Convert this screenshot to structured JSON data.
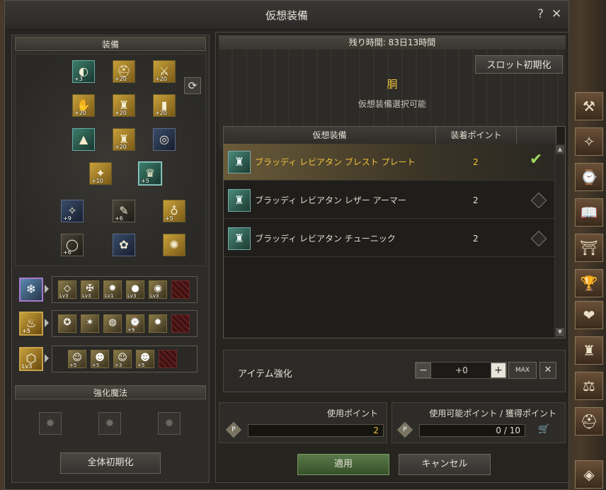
{
  "window": {
    "title": "仮想装備"
  },
  "left": {
    "equip_header": "装備",
    "equip_slots": [
      {
        "icon": "mask-icon",
        "glyph": "◐",
        "count": "+3",
        "style": "teal"
      },
      {
        "icon": "helmet-icon",
        "glyph": "⛑",
        "count": "+20",
        "style": "gold"
      },
      {
        "icon": "shoulder-icon",
        "glyph": "⚔",
        "count": "+20",
        "style": "gold"
      },
      {
        "icon": "gloves-icon",
        "glyph": "✋",
        "count": "+20",
        "style": "gold"
      },
      {
        "icon": "armor-icon",
        "glyph": "♜",
        "count": "+20",
        "style": "gold"
      },
      {
        "icon": "greaves-icon",
        "glyph": "▮",
        "count": "+20",
        "style": "gold"
      },
      {
        "icon": "cloak-icon",
        "glyph": "▲",
        "count": "",
        "style": "teal"
      },
      {
        "icon": "belt-icon",
        "glyph": "♜",
        "count": "+20",
        "style": "gold"
      },
      {
        "icon": "bracelet-icon",
        "glyph": "◎",
        "count": "",
        "style": "blue"
      },
      {
        "icon": "weapon-icon",
        "glyph": "✦",
        "count": "+10",
        "style": "gold"
      },
      {
        "icon": "chest-selected-icon",
        "glyph": "♛",
        "count": "+5",
        "style": "teal"
      },
      {
        "icon": "pendant-icon",
        "glyph": "✧",
        "count": "+9",
        "style": "blue"
      },
      {
        "icon": "book-icon",
        "glyph": "✎",
        "count": "+6",
        "style": "dark"
      },
      {
        "icon": "shirt-icon",
        "glyph": "♁",
        "count": "+5",
        "style": "gold"
      },
      {
        "icon": "ring-icon",
        "glyph": "◯",
        "count": "+6",
        "style": "dark"
      },
      {
        "icon": "rose-icon",
        "glyph": "✿",
        "count": "",
        "style": "blue"
      },
      {
        "icon": "amulet-icon",
        "glyph": "✺",
        "count": "",
        "style": "gold"
      }
    ],
    "sets": [
      {
        "main": {
          "icon": "crystal-icon",
          "glyph": "❄",
          "count": "",
          "style": "purple"
        },
        "gems": [
          {
            "icon": "diamond-icon",
            "glyph": "◇",
            "lv": "Lv3"
          },
          {
            "icon": "emerald-icon",
            "glyph": "✠",
            "lv": "Lv3"
          },
          {
            "icon": "ruby-icon",
            "glyph": "✹",
            "lv": "Lv1"
          },
          {
            "icon": "pearl-icon",
            "glyph": "●",
            "lv": "Lv3"
          },
          {
            "icon": "sapphire-icon",
            "glyph": "◉",
            "lv": "Lv3"
          },
          {
            "icon": "empty-slot-icon",
            "glyph": "",
            "lv": "",
            "red": true
          }
        ]
      },
      {
        "main": {
          "icon": "orb-icon",
          "glyph": "♨",
          "count": "+5",
          "style": "gold"
        },
        "gems": [
          {
            "icon": "demon-gem-icon",
            "glyph": "✪",
            "lv": ""
          },
          {
            "icon": "star-gem-icon",
            "glyph": "✶",
            "lv": ""
          },
          {
            "icon": "pearl-gem-icon",
            "glyph": "◍",
            "lv": ""
          },
          {
            "icon": "clock-gem-icon",
            "glyph": "⌚",
            "lv": "+9"
          },
          {
            "icon": "flame-gem-icon",
            "glyph": "✹",
            "lv": ""
          },
          {
            "icon": "empty-slot-icon",
            "glyph": "",
            "lv": "",
            "red": true
          }
        ]
      },
      {
        "main": {
          "icon": "hexagon-icon",
          "glyph": "⬡",
          "count": "Lv3",
          "style": "gold"
        },
        "gems": [
          {
            "icon": "doll-pink-icon",
            "glyph": "☺",
            "lv": "+5"
          },
          {
            "icon": "doll-red-icon",
            "glyph": "☻",
            "lv": "+5"
          },
          {
            "icon": "doll-orange-icon",
            "glyph": "☺",
            "lv": "+3"
          },
          {
            "icon": "doll-cat-icon",
            "glyph": "☻",
            "lv": "+5"
          },
          {
            "icon": "empty-slot-icon",
            "glyph": "",
            "lv": "",
            "red": true
          }
        ]
      }
    ],
    "magic_header": "強化魔法",
    "reset_all_label": "全体初期化"
  },
  "right": {
    "remaining": "残り時間: 83日13時間",
    "slot_reset_label": "スロット初期化",
    "part_name": "胴",
    "part_sub": "仮想装備選択可能",
    "table_headers": [
      "仮想装備",
      "装着ポイント"
    ],
    "rows": [
      {
        "name": "ブラッディ レビアタン ブレスト プレート",
        "points": "2",
        "selected": true
      },
      {
        "name": "ブラッディ レビアタン レザー アーマー",
        "points": "2",
        "selected": false
      },
      {
        "name": "ブラッディ レビアタン チューニック",
        "points": "2",
        "selected": false
      }
    ],
    "enhance_label": "アイテム強化",
    "enhance_value": "+0",
    "max_label": "MAX",
    "used_points_label": "使用ポイント",
    "used_points_value": "2",
    "avail_points_label": "使用可能ポイント / 獲得ポイント",
    "avail_points_value": "0 / 10",
    "apply_label": "適用",
    "cancel_label": "キャンセル"
  },
  "sidebar_icons": [
    "axes-icon",
    "compass-star-icon",
    "clock-icon",
    "open-book-icon",
    "temple-icon",
    "trophy-icon",
    "heart-icon",
    "armor-stand-icon",
    "scales-icon",
    "knight-helmet-icon",
    "diamond-badge-icon"
  ],
  "colors": {
    "accent_gold": "#f2c23a",
    "check_green": "#9fd860"
  }
}
